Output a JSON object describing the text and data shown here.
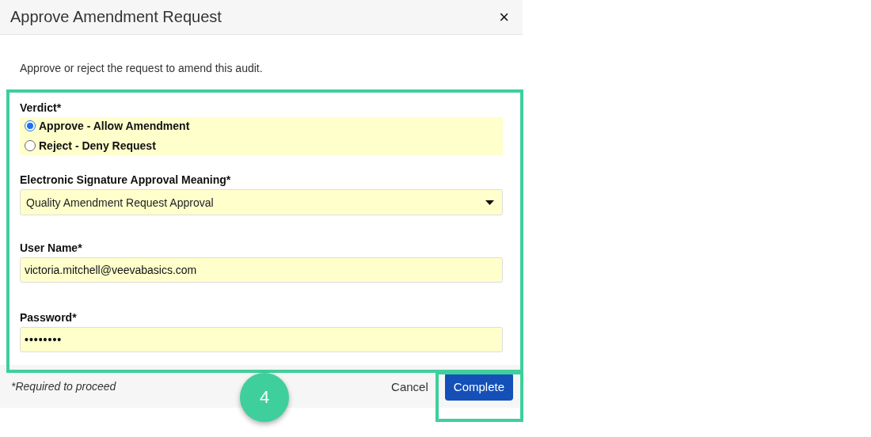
{
  "dialog": {
    "title": "Approve Amendment Request",
    "close": "×",
    "description": "Approve or reject the request to amend this audit.",
    "verdict": {
      "label": "Verdict*",
      "options": [
        {
          "label": "Approve - Allow Amendment",
          "selected": true
        },
        {
          "label": "Reject - Deny Request",
          "selected": false
        }
      ]
    },
    "meaning": {
      "label": "Electronic Signature Approval Meaning*",
      "value": "Quality Amendment Request Approval"
    },
    "user_name": {
      "label": "User Name*",
      "value": "victoria.mitchell@veevabasics.com"
    },
    "password": {
      "label": "Password*",
      "value": "••••••••"
    },
    "footer": {
      "note": "*Required to proceed",
      "cancel": "Cancel",
      "complete": "Complete"
    }
  },
  "step_badge": "4"
}
